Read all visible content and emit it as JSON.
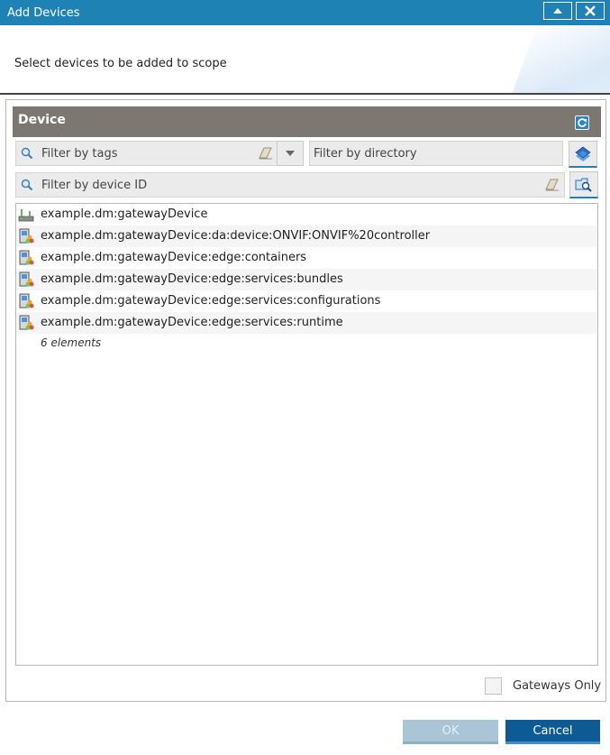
{
  "window": {
    "title": "Add Devices",
    "subtitle": "Select devices to be added to scope"
  },
  "panel": {
    "title": "Device"
  },
  "filters": {
    "tags_placeholder": "Filter by tags",
    "directory_placeholder": "Filter by directory",
    "device_id_placeholder": "Filter by device ID"
  },
  "devices": [
    {
      "id": "example.dm:gatewayDevice",
      "icon": "gateway-icon"
    },
    {
      "id": "example.dm:gatewayDevice:da:device:ONVIF:ONVIF%20controller",
      "icon": "device-icon"
    },
    {
      "id": "example.dm:gatewayDevice:edge:containers",
      "icon": "device-icon"
    },
    {
      "id": "example.dm:gatewayDevice:edge:services:bundles",
      "icon": "device-icon"
    },
    {
      "id": "example.dm:gatewayDevice:edge:services:configurations",
      "icon": "device-icon"
    },
    {
      "id": "example.dm:gatewayDevice:edge:services:runtime",
      "icon": "device-icon"
    }
  ],
  "list_count": "6 elements",
  "gateways_only": {
    "label": "Gateways Only",
    "checked": false
  },
  "buttons": {
    "ok": "OK",
    "cancel": "Cancel"
  },
  "colors": {
    "accent": "#1f82b5",
    "panel_header": "#7d7771",
    "cancel": "#0d5a94",
    "ok_disabled": "#a9c5d6"
  }
}
